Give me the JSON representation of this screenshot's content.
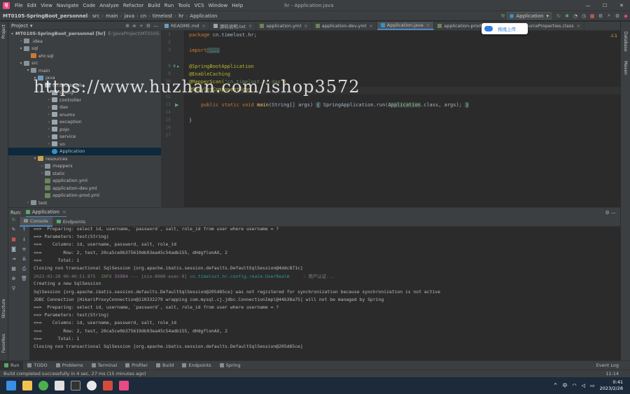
{
  "menu": {
    "items": [
      "File",
      "Edit",
      "View",
      "Navigate",
      "Code",
      "Analyze",
      "Refactor",
      "Build",
      "Run",
      "Tools",
      "VCS",
      "Window",
      "Help"
    ],
    "window_title": "hr - Application.java",
    "controls": [
      "—",
      "☐",
      "✕"
    ]
  },
  "nav": {
    "project": "MT0105-SpringBoot_personnel",
    "crumbs": [
      "src",
      "main",
      "java",
      "cn",
      "timelost",
      "hr",
      "Application"
    ],
    "run_config": "Application"
  },
  "left_stripe": {
    "project": "Project",
    "structure": "Structure",
    "favorites": "Favorites"
  },
  "right_stripe": {
    "database": "Database",
    "maven": "Maven"
  },
  "project_panel": {
    "title": "Project",
    "tree": [
      {
        "label": "MT0105-SpringBoot_personnel [hr]",
        "suffix": "E:\\JavaProject\\MT0105-SpringBo",
        "indent": 0,
        "arrow": "▾",
        "icon": "folder",
        "bold": true
      },
      {
        "label": ".idea",
        "indent": 1,
        "arrow": "›",
        "icon": "folder"
      },
      {
        "label": "sql",
        "indent": 1,
        "arrow": "▾",
        "icon": "folder"
      },
      {
        "label": "ehr.sql",
        "indent": 2,
        "arrow": "",
        "icon": "sqlf"
      },
      {
        "label": "src",
        "indent": 1,
        "arrow": "▾",
        "icon": "folder"
      },
      {
        "label": "main",
        "indent": 2,
        "arrow": "▾",
        "icon": "folder"
      },
      {
        "label": "java",
        "indent": 3,
        "arrow": "▾",
        "icon": "srcf"
      },
      {
        "label": "cn.timelost.hr",
        "indent": 4,
        "arrow": "▾",
        "icon": "pkg"
      },
      {
        "label": "config",
        "indent": 5,
        "arrow": "›",
        "icon": "pkg"
      },
      {
        "label": "controller",
        "indent": 5,
        "arrow": "›",
        "icon": "pkg"
      },
      {
        "label": "dao",
        "indent": 5,
        "arrow": "›",
        "icon": "pkg"
      },
      {
        "label": "enums",
        "indent": 5,
        "arrow": "›",
        "icon": "pkg"
      },
      {
        "label": "exception",
        "indent": 5,
        "arrow": "›",
        "icon": "pkg"
      },
      {
        "label": "pojo",
        "indent": 5,
        "arrow": "›",
        "icon": "pkg"
      },
      {
        "label": "service",
        "indent": 5,
        "arrow": "›",
        "icon": "pkg"
      },
      {
        "label": "vo",
        "indent": 5,
        "arrow": "›",
        "icon": "pkg"
      },
      {
        "label": "Application",
        "indent": 5,
        "arrow": "",
        "icon": "javaf",
        "selected": true
      },
      {
        "label": "resources",
        "indent": 3,
        "arrow": "▾",
        "icon": "resf"
      },
      {
        "label": "mappers",
        "indent": 4,
        "arrow": "›",
        "icon": "folder"
      },
      {
        "label": "static",
        "indent": 4,
        "arrow": "›",
        "icon": "folder"
      },
      {
        "label": "application.yml",
        "indent": 4,
        "arrow": "",
        "icon": "ymlf"
      },
      {
        "label": "application-dev.yml",
        "indent": 4,
        "arrow": "",
        "icon": "ymlf"
      },
      {
        "label": "application-prod.yml",
        "indent": 4,
        "arrow": "",
        "icon": "ymlf"
      },
      {
        "label": "test",
        "indent": 2,
        "arrow": "›",
        "icon": "folder"
      }
    ]
  },
  "tabs": [
    {
      "label": "README.md",
      "icon": "#6d9cbe"
    },
    {
      "label": "源码说明.txt",
      "icon": "#9aa7b0"
    },
    {
      "label": "application.yml",
      "icon": "#6a8759"
    },
    {
      "label": "application-dev.yml",
      "icon": "#6a8759"
    },
    {
      "label": "Application.java",
      "icon": "#3592c4",
      "active": true
    },
    {
      "label": "application-prod.yml",
      "icon": "#6a8759"
    },
    {
      "label": "DataSourceProperties.class",
      "icon": "#9aa7b0"
    }
  ],
  "popup": {
    "label": "拖拽上传"
  },
  "editor": {
    "warnings": "⚠1",
    "line_numbers": [
      "1",
      "2",
      "3",
      "8",
      "9",
      "10",
      "11",
      "12",
      "13",
      "14",
      "15",
      "16",
      "17"
    ],
    "line1": {
      "kw": "package",
      "rest": " cn.timelost.hr;"
    },
    "line3": {
      "kw": "import",
      "rest": " ..."
    },
    "ann1": "@SpringBootApplication",
    "ann2": "@EnableCaching",
    "ann3a": "@MapperScan(",
    "ann3s": "\"cn.timelost.hr.dao\"",
    "ann3b": ")",
    "ann4": "@ServletComponentScan",
    "main": {
      "kw": "public static void",
      "fn": "main",
      "args": "(String[] args) ",
      "lb": "{",
      "body": " SpringApplication.run(",
      "app": "Application",
      "rest": ".class, args); ",
      "rb": "}"
    },
    "close": "}"
  },
  "watermark": "https://www.huzhan.com/ishop3572",
  "run": {
    "label": "Run:",
    "config": "Application",
    "tabs": [
      "Console",
      "Endpoints"
    ]
  },
  "console": [
    {
      "parts": [
        {
          "t": "==>  Preparing: select id, username, `password`, salt, role_id from user where username = ?",
          "c": ""
        }
      ]
    },
    {
      "parts": [
        {
          "t": "==> Parameters: test(String)",
          "c": ""
        }
      ]
    },
    {
      "parts": [
        {
          "t": "<==    Columns: id, username, password, salt, role_id",
          "c": ""
        }
      ]
    },
    {
      "parts": [
        {
          "t": "<==        Row: 2, test, 20ca5ce0b375619db93ea45c54adb155, dHdgflonAX, 2",
          "c": ""
        }
      ]
    },
    {
      "parts": [
        {
          "t": "<==      Total: 1",
          "c": ""
        }
      ]
    },
    {
      "parts": [
        {
          "t": "Closing non transactional SqlSession [org.apache.ibatis.session.defaults.DefaultSqlSession@4ddc871c]",
          "c": ""
        }
      ]
    },
    {
      "parts": [
        {
          "t": "2023-02-28 00:40:51.875  ",
          "c": "gray"
        },
        {
          "t": "INFO",
          "c": "info"
        },
        {
          "t": " 35984",
          "c": "pid"
        },
        {
          "t": " --- [nio-8080-exec-9] ",
          "c": "gray"
        },
        {
          "t": "cn.timelost.hr.config.realm.UserRealm    ",
          "c": "cyan"
        },
        {
          "t": " : 用户认证...",
          "c": "gray"
        }
      ]
    },
    {
      "parts": [
        {
          "t": "Creating a new SqlSession",
          "c": ""
        }
      ]
    },
    {
      "parts": [
        {
          "t": "SqlSession [org.apache.ibatis.session.defaults.DefaultSqlSession@205d85ce] was not registered for synchronization because synchronization is not active",
          "c": ""
        }
      ]
    },
    {
      "parts": [
        {
          "t": "JDBC Connection [HikariProxyConnection@110332279 wrapping com.mysql.cj.jdbc.ConnectionImpl@44b38a75] will not be managed by Spring",
          "c": ""
        }
      ]
    },
    {
      "parts": [
        {
          "t": "==>  Preparing: select id, username, `password`, salt, role_id from user where username = ?",
          "c": ""
        }
      ]
    },
    {
      "parts": [
        {
          "t": "==> Parameters: test(String)",
          "c": ""
        }
      ]
    },
    {
      "parts": [
        {
          "t": "<==    Columns: id, username, password, salt, role_id",
          "c": ""
        }
      ]
    },
    {
      "parts": [
        {
          "t": "<==        Row: 2, test, 20ca5ce0b375619db93ea45c54adb155, dHdgflonAX, 2",
          "c": ""
        }
      ]
    },
    {
      "parts": [
        {
          "t": "<==      Total: 1",
          "c": ""
        }
      ]
    },
    {
      "parts": [
        {
          "t": "Closing non transactional SqlSession [org.apache.ibatis.session.defaults.DefaultSqlSession@205d85ce]",
          "c": ""
        }
      ]
    }
  ],
  "toolwindows": [
    "Run",
    "TODO",
    "Problems",
    "Terminal",
    "Profiler",
    "Build",
    "Endpoints",
    "Spring"
  ],
  "event_log": "Event Log",
  "status": {
    "message": "Build completed successfully in 4 sec, 27 ms (15 minutes ago)",
    "position": "11:14"
  },
  "taskbar": {
    "ime": "中",
    "time": "0:41",
    "date": "2023/2/28"
  }
}
